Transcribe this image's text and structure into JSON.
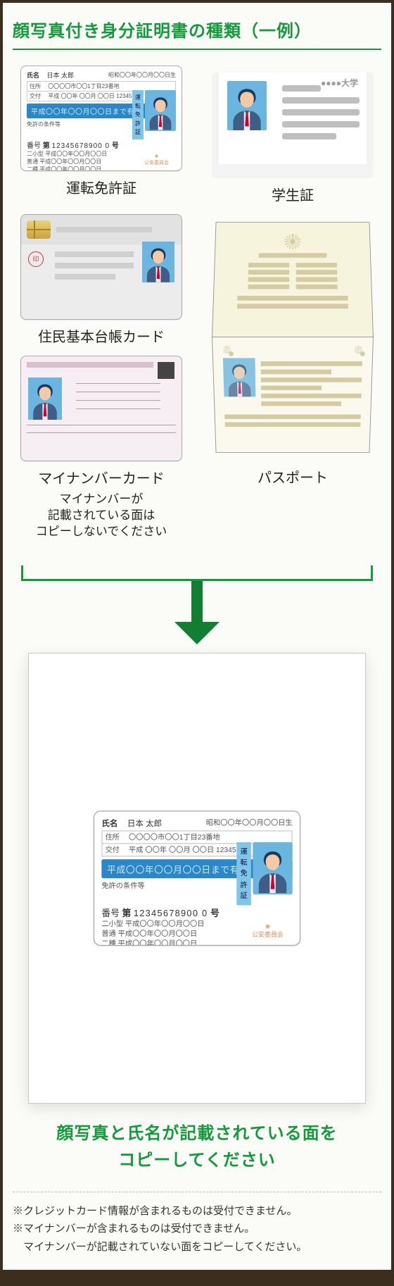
{
  "title": "顔写真付き身分証明書の種類（一例）",
  "dlc": {
    "label": "運転免許証",
    "name_label": "氏名",
    "name_value": "日本 太郎",
    "dob_label": "昭和〇〇年〇〇月〇〇日生",
    "addr_label": "住所",
    "addr_value": "〇〇〇〇市〇〇1丁目23番地",
    "issue_label": "交付",
    "issue_value": "平成 〇〇年 〇〇月 〇〇日 12345",
    "validity": "平成〇〇年〇〇月〇〇日まで有効",
    "side_chars": [
      "運",
      "転",
      "免",
      "許",
      "証"
    ],
    "cond_label": "免許の条件等",
    "num_label": "番号",
    "num_prefix": "第",
    "num_value": "12345678900 0",
    "num_suffix": "号",
    "row1": "二小型 平成〇〇年〇〇月〇〇日",
    "row2": "普通 平成〇〇年〇〇月〇〇日",
    "row3": "二種 平成〇〇年〇〇月〇〇日",
    "stamp": "公安委員会"
  },
  "student": {
    "label": "学生証",
    "univ": "●●●●大学"
  },
  "juki": {
    "label": "住民基本台帳カード",
    "inkan": "印"
  },
  "mynumber": {
    "label": "マイナンバーカード",
    "note": "マイナンバーが\n記載されている面は\nコピーしないでください"
  },
  "passport": {
    "label": "パスポート"
  },
  "copynote": "顔写真と氏名が記載されている面を\nコピーしてください",
  "footnotes": [
    "※クレジットカード情報が含まれるものは受付できません。",
    "※マイナンバーが含まれるものは受付できません。",
    "　マイナンバーが記載されていない面をコピーしてください。"
  ]
}
